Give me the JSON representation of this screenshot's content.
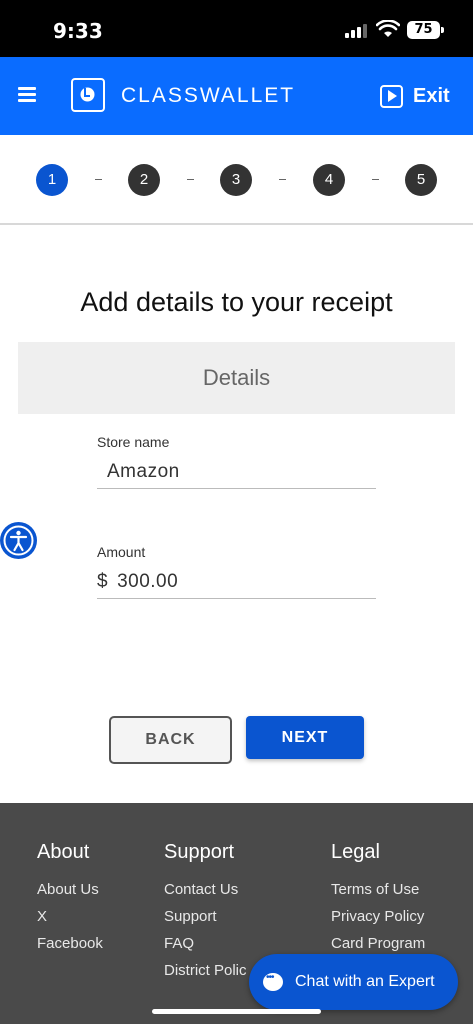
{
  "status_bar": {
    "time": "9:33",
    "battery": "75"
  },
  "header": {
    "logo_text": "CLASSWALLET",
    "exit_label": "Exit"
  },
  "stepper": {
    "steps": [
      "1",
      "2",
      "3",
      "4",
      "5"
    ],
    "active": "1",
    "separator": "-"
  },
  "page": {
    "title": "Add details to your receipt",
    "section_label": "Details"
  },
  "form": {
    "store_name_label": "Store name",
    "store_name_value": "Amazon",
    "amount_label": "Amount",
    "currency_symbol": "$",
    "amount_value": "300.00"
  },
  "buttons": {
    "back": "BACK",
    "next": "NEXT"
  },
  "footer": {
    "about": {
      "heading": "About",
      "links": [
        "About Us",
        "X",
        "Facebook"
      ]
    },
    "support": {
      "heading": "Support",
      "links": [
        "Contact Us",
        "Support",
        "FAQ",
        "District Polic"
      ]
    },
    "legal": {
      "heading": "Legal",
      "links": [
        "Terms of Use",
        "Privacy Policy",
        "Card Program"
      ]
    }
  },
  "chat": {
    "label": "Chat with an Expert"
  },
  "colors": {
    "header_blue": "#0a6cff",
    "primary_blue": "#0a55d0",
    "footer_gray": "#4a4a4a"
  },
  "icons": [
    "menu-icon",
    "logo-icon",
    "exit-icon",
    "accessibility-icon",
    "chat-icon",
    "signal-icon",
    "wifi-icon",
    "battery-icon"
  ]
}
